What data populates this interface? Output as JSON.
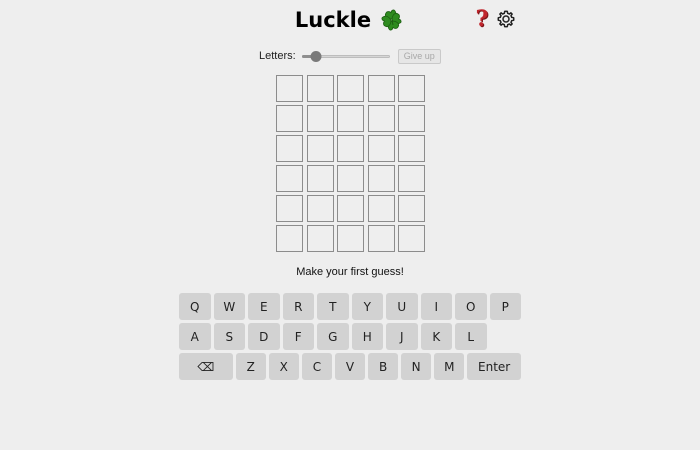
{
  "header": {
    "title": "Luckle",
    "clover_icon": "four-leaf-clover-icon",
    "help_icon_glyph": "?",
    "settings_icon": "gear-icon",
    "accent_help_color": "#c0262d",
    "clover_color": "#2e8b1f"
  },
  "controls": {
    "letters_label": "Letters:",
    "letters_slider_value": 0.15,
    "give_up_label": "Give up"
  },
  "board": {
    "rows": 6,
    "cols": 5,
    "tiles": [
      [
        "",
        "",
        "",
        "",
        ""
      ],
      [
        "",
        "",
        "",
        "",
        ""
      ],
      [
        "",
        "",
        "",
        "",
        ""
      ],
      [
        "",
        "",
        "",
        "",
        ""
      ],
      [
        "",
        "",
        "",
        "",
        ""
      ],
      [
        "",
        "",
        "",
        "",
        ""
      ]
    ]
  },
  "message": "Make your first guess!",
  "keyboard": {
    "row1": [
      "Q",
      "W",
      "E",
      "R",
      "T",
      "Y",
      "U",
      "I",
      "O",
      "P"
    ],
    "row2": [
      "A",
      "S",
      "D",
      "F",
      "G",
      "H",
      "J",
      "K",
      "L"
    ],
    "row3_backspace": "⌫",
    "row3": [
      "Z",
      "X",
      "C",
      "V",
      "B",
      "N",
      "M"
    ],
    "row3_enter": "Enter"
  }
}
